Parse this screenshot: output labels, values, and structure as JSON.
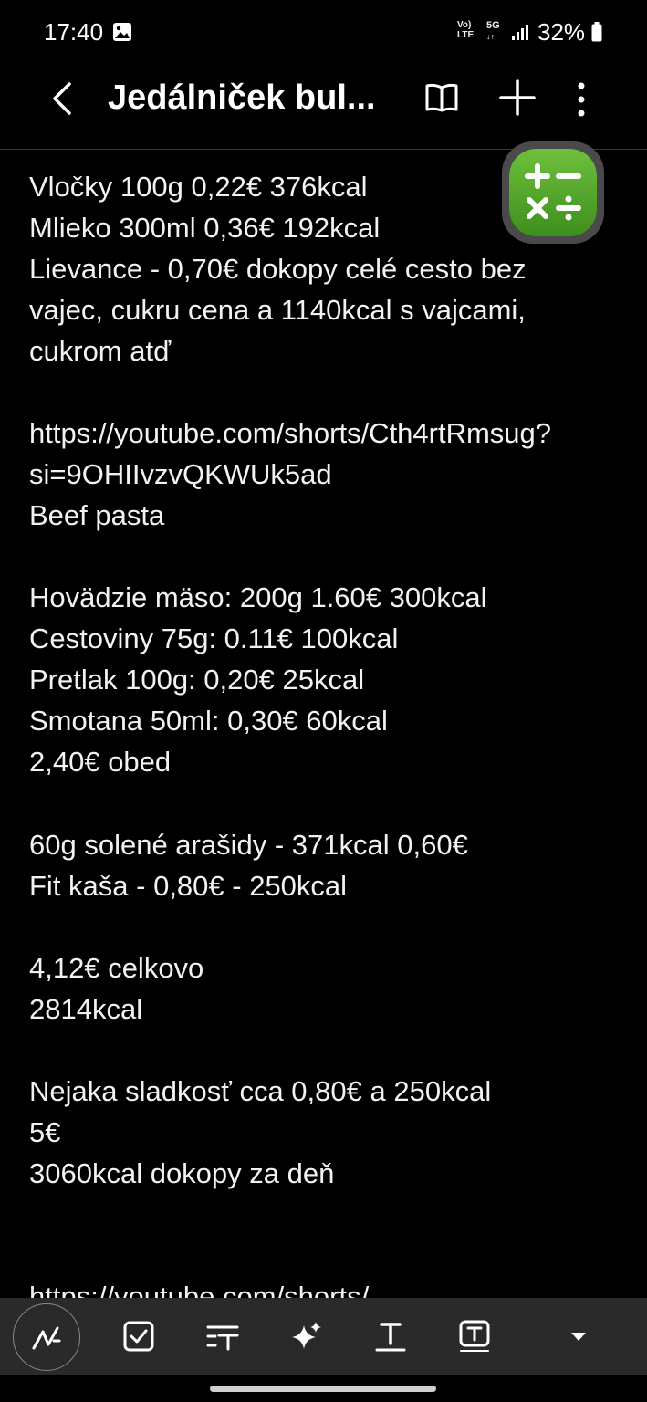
{
  "status": {
    "time": "17:40",
    "volte_label_1": "Vo)",
    "volte_label_2": "LTE",
    "net_label_1": "5G",
    "net_label_2": "↓↑",
    "battery": "32%"
  },
  "header": {
    "title": "Jedálniček bul..."
  },
  "note": {
    "lines": [
      "Vločky 100g 0,22€ 376kcal",
      "Mlieko 300ml 0,36€ 192kcal",
      "Lievance - 0,70€ dokopy celé cesto bez",
      "vajec, cukru cena a  1140kcal  s vajcami,",
      "cukrom atď",
      "https://youtube.com/shorts/Cth4rtRmsug?",
      "si=9OHIIvzvQKWUk5ad",
      "Beef pasta",
      "Hovädzie mäso: 200g 1.60€ 300kcal",
      "Cestoviny 75g: 0.11€ 100kcal",
      "Pretlak 100g: 0,20€ 25kcal",
      "Smotana 50ml: 0,30€ 60kcal",
      "2,40€ obed",
      "60g solené arašidy - 371kcal 0,60€",
      "Fit kaša - 0,80€ - 250kcal",
      "4,12€ celkovo",
      "2814kcal",
      "Nejaka sladkosť cca 0,80€ a 250kcal",
      "5€",
      "3060kcal dokopy za deň",
      "https://youtube.com/shorts/"
    ]
  },
  "icons": {
    "back": "back-arrow-icon",
    "reader": "book-icon",
    "add": "plus-icon",
    "more": "more-vertical-icon",
    "calculator": "calculator-icon",
    "pen": "pen-icon",
    "checklist": "checkbox-icon",
    "text_size": "text-size-icon",
    "ai": "sparkle-icon",
    "text_style": "text-format-icon",
    "text_box": "text-box-icon",
    "expand": "chevron-down-icon"
  },
  "colors": {
    "background": "#000000",
    "toolbar": "#2a2a2a",
    "calculator_green": "#4fa52a"
  }
}
